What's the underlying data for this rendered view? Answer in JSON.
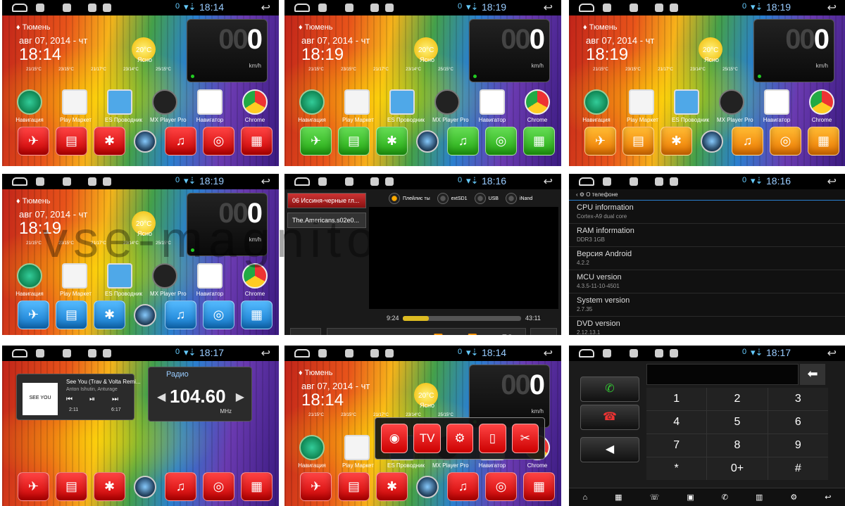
{
  "status": {
    "zero": "0",
    "wifi": "▾⇣",
    "back": "↩"
  },
  "home": {
    "city": "♦ Тюмень",
    "date": "авг 07, 2014 - чт",
    "temp": "20°C",
    "condition": "Ясно",
    "forecast": [
      "21/15°C",
      "23/15°C",
      "21/17°C",
      "23/14°C",
      "25/15°C"
    ],
    "speed_dim": "00",
    "speed_main": "0",
    "speed_unit": "km/h",
    "apps": [
      "Навигация",
      "Play Маркет",
      "ES Проводник",
      "MX Player Pro",
      "Навигатор",
      "Chrome"
    ],
    "dock_icons": [
      "compass-icon",
      "radio-icon",
      "bluetooth-icon",
      "home-circle-icon",
      "music-icon",
      "video-icon",
      "grid-icon"
    ],
    "dock_glyphs": [
      "✈",
      "▤",
      "✱",
      "",
      "♫",
      "◎",
      "▦"
    ]
  },
  "panels": [
    {
      "time": "18:14",
      "clock": "18:14",
      "theme": "red"
    },
    {
      "time": "18:19",
      "clock": "18:19",
      "theme": "green"
    },
    {
      "time": "18:19",
      "clock": "18:19",
      "theme": "orange"
    },
    {
      "time": "18:19",
      "clock": "18:19",
      "theme": "blue"
    },
    {
      "time": "18:16"
    },
    {
      "time": "18:16"
    },
    {
      "time": "18:17"
    },
    {
      "time": "18:14",
      "clock": "18:14",
      "theme": "red"
    },
    {
      "time": "18:17"
    }
  ],
  "player": {
    "tracks": [
      "06 Иссиня-черные гл...",
      "The.Americans.s02e0..."
    ],
    "sources": [
      "Плейлис ты",
      "extSD1",
      "USB",
      "iNand"
    ],
    "position": "9:24",
    "duration": "43:11",
    "progress": 0.22,
    "controls": [
      "⏮",
      "⏯",
      "⏭",
      "⏪",
      "⏩",
      "EQ"
    ],
    "home": "⌂",
    "back": "↩"
  },
  "about": {
    "header": "‹ ⚙ О телефоне",
    "rows": [
      {
        "k": "CPU information",
        "v": "Cortex-A9 dual core"
      },
      {
        "k": "RAM information",
        "v": "DDR3 1GB"
      },
      {
        "k": "Версия Android",
        "v": "4.2.2"
      },
      {
        "k": "MCU version",
        "v": "4.3.5-11-10-4501"
      },
      {
        "k": "System version",
        "v": "2.7.35"
      },
      {
        "k": "DVD version",
        "v": "2.12.13.1"
      }
    ]
  },
  "widgets": {
    "cover": "SEE YOU",
    "song": "See You (Trav & Volta Remi...",
    "artist": "Anton Ishutin, Anturage",
    "elapsed": "2:11",
    "total": "6:17",
    "radio_label": "Радио",
    "freq": "104.60",
    "mhz": "MHz"
  },
  "popup": {
    "glyphs": [
      "◉",
      "TV",
      "⚙",
      "▯",
      "✂"
    ]
  },
  "dialer": {
    "keys": [
      "1",
      "2",
      "3",
      "4",
      "5",
      "6",
      "7",
      "8",
      "9",
      "*",
      "0+",
      "#"
    ],
    "backspace": "⬅",
    "call": "✆",
    "hangup": "☎",
    "mute": "◀",
    "bottom": [
      "⌂",
      "▦",
      "☏",
      "▣",
      "✆",
      "▥",
      "⚙",
      "↩"
    ]
  },
  "watermark": "vse-magnitoly.ru"
}
